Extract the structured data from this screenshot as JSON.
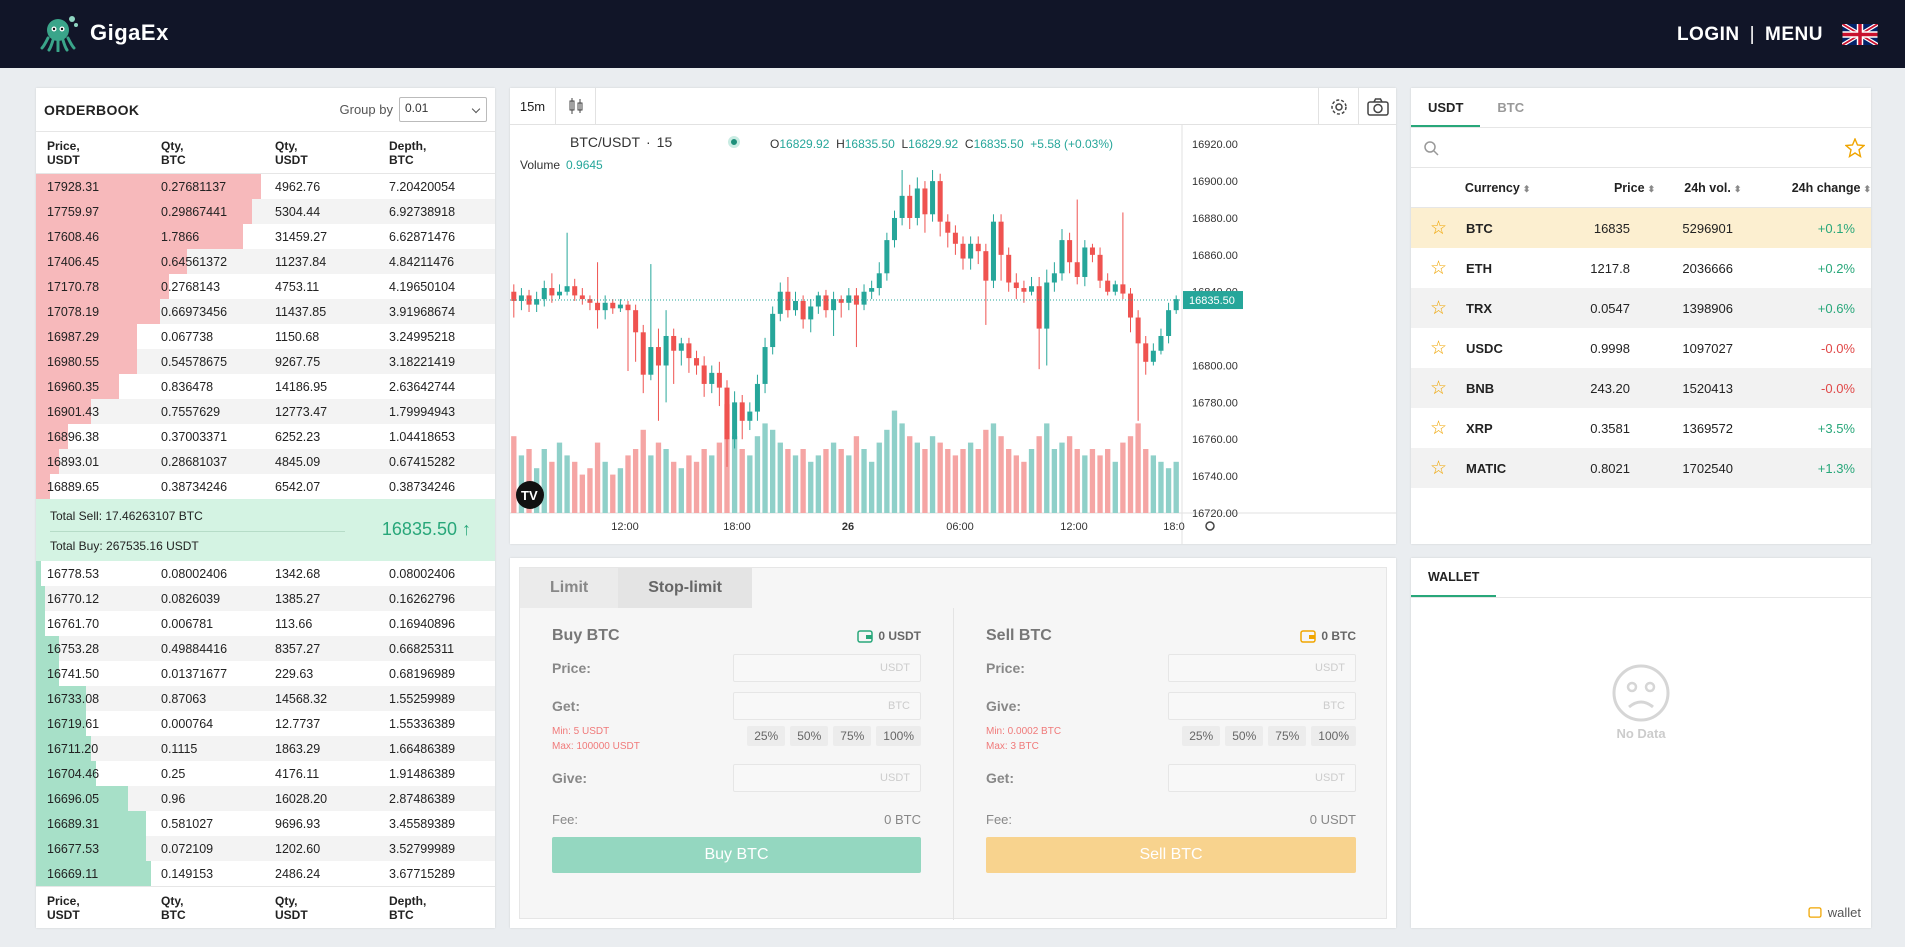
{
  "brand": {
    "name": "GigaEx"
  },
  "nav": {
    "login": "LOGIN",
    "separator": "|",
    "menu": "MENU"
  },
  "orderbook": {
    "title": "ORDERBOOK",
    "group_label": "Group by",
    "group_value": "0.01",
    "headers": [
      "Price,\nUSDT",
      "Qty,\nBTC",
      "Qty,\nUSDT",
      "Depth,\nBTC"
    ],
    "sells": [
      {
        "price": "17928.31",
        "qty": "0.27681137",
        "usdt": "4962.76",
        "depth": "7.20420054",
        "fill": 0.49
      },
      {
        "price": "17759.97",
        "qty": "0.29867441",
        "usdt": "5304.44",
        "depth": "6.92738918",
        "fill": 0.47
      },
      {
        "price": "17608.46",
        "qty": "1.7866",
        "usdt": "31459.27",
        "depth": "6.62871476",
        "fill": 0.45
      },
      {
        "price": "17406.45",
        "qty": "0.64561372",
        "usdt": "11237.84",
        "depth": "4.84211476",
        "fill": 0.33
      },
      {
        "price": "17170.78",
        "qty": "0.2768143",
        "usdt": "4753.11",
        "depth": "4.19650104",
        "fill": 0.29
      },
      {
        "price": "17078.19",
        "qty": "0.66973456",
        "usdt": "11437.85",
        "depth": "3.91968674",
        "fill": 0.27
      },
      {
        "price": "16987.29",
        "qty": "0.067738",
        "usdt": "1150.68",
        "depth": "3.24995218",
        "fill": 0.22
      },
      {
        "price": "16980.55",
        "qty": "0.54578675",
        "usdt": "9267.75",
        "depth": "3.18221419",
        "fill": 0.22
      },
      {
        "price": "16960.35",
        "qty": "0.836478",
        "usdt": "14186.95",
        "depth": "2.63642744",
        "fill": 0.18
      },
      {
        "price": "16901.43",
        "qty": "0.7557629",
        "usdt": "12773.47",
        "depth": "1.79994943",
        "fill": 0.12
      },
      {
        "price": "16896.38",
        "qty": "0.37003371",
        "usdt": "6252.23",
        "depth": "1.04418653",
        "fill": 0.07
      },
      {
        "price": "16893.01",
        "qty": "0.28681037",
        "usdt": "4845.09",
        "depth": "0.67415282",
        "fill": 0.05
      },
      {
        "price": "16889.65",
        "qty": "0.38734246",
        "usdt": "6542.07",
        "depth": "0.38734246",
        "fill": 0.03
      }
    ],
    "total_sell": "Total Sell: 17.46263107 BTC",
    "total_buy": "Total Buy: 267535.16 USDT",
    "last_price": "16835.50",
    "buys": [
      {
        "price": "16778.53",
        "qty": "0.08002406",
        "usdt": "1342.68",
        "depth": "0.08002406",
        "fill": 0.01
      },
      {
        "price": "16770.12",
        "qty": "0.0826039",
        "usdt": "1385.27",
        "depth": "0.16262796",
        "fill": 0.02
      },
      {
        "price": "16761.70",
        "qty": "0.006781",
        "usdt": "113.66",
        "depth": "0.16940896",
        "fill": 0.02
      },
      {
        "price": "16753.28",
        "qty": "0.49884416",
        "usdt": "8357.27",
        "depth": "0.66825311",
        "fill": 0.05
      },
      {
        "price": "16741.50",
        "qty": "0.01371677",
        "usdt": "229.63",
        "depth": "0.68196989",
        "fill": 0.05
      },
      {
        "price": "16733.08",
        "qty": "0.87063",
        "usdt": "14568.32",
        "depth": "1.55259989",
        "fill": 0.11
      },
      {
        "price": "16719.61",
        "qty": "0.000764",
        "usdt": "12.7737",
        "depth": "1.55336389",
        "fill": 0.11
      },
      {
        "price": "16711.20",
        "qty": "0.1115",
        "usdt": "1863.29",
        "depth": "1.66486389",
        "fill": 0.12
      },
      {
        "price": "16704.46",
        "qty": "0.25",
        "usdt": "4176.11",
        "depth": "1.91486389",
        "fill": 0.13
      },
      {
        "price": "16696.05",
        "qty": "0.96",
        "usdt": "16028.20",
        "depth": "2.87486389",
        "fill": 0.2
      },
      {
        "price": "16689.31",
        "qty": "0.581027",
        "usdt": "9696.93",
        "depth": "3.45589389",
        "fill": 0.24
      },
      {
        "price": "16677.53",
        "qty": "0.072109",
        "usdt": "1202.60",
        "depth": "3.52799989",
        "fill": 0.24
      },
      {
        "price": "16669.11",
        "qty": "0.149153",
        "usdt": "2486.24",
        "depth": "3.67715289",
        "fill": 0.25
      }
    ]
  },
  "chart": {
    "timeframe": "15m",
    "symbol": "BTC/USDT",
    "interval": "15",
    "ohlc": {
      "o": "16829.92",
      "h": "16835.50",
      "l": "16829.92",
      "c": "16835.50",
      "chg": "+5.58 (+0.03%)"
    },
    "volume_label": "Volume",
    "volume_value": "0.9645",
    "price_tag": "16835.50",
    "y_ticks": [
      "16920.00",
      "16900.00",
      "16880.00",
      "16860.00",
      "16840.00",
      "16800.00",
      "16780.00",
      "16760.00",
      "16740.00",
      "16720.00"
    ],
    "x_ticks": [
      "12:00",
      "18:00",
      "26",
      "06:00",
      "12:00",
      "18:0"
    ]
  },
  "chart_data": {
    "type": "candlestick",
    "ylim": [
      16720,
      16925
    ],
    "last": 16835.5,
    "candles": [
      [
        16840,
        16835,
        16844,
        16826
      ],
      [
        16835,
        16838,
        16842,
        16830
      ],
      [
        16838,
        16833,
        16841,
        16829
      ],
      [
        16833,
        16836,
        16840,
        16829
      ],
      [
        16836,
        16842,
        16846,
        16832
      ],
      [
        16842,
        16838,
        16850,
        16834
      ],
      [
        16838,
        16840,
        16844,
        16836
      ],
      [
        16840,
        16843,
        16872,
        16838
      ],
      [
        16843,
        16838,
        16847,
        16835
      ],
      [
        16838,
        16836,
        16842,
        16833
      ],
      [
        16836,
        16834,
        16838,
        16830
      ],
      [
        16834,
        16830,
        16856,
        16820
      ],
      [
        16830,
        16834,
        16838,
        16825
      ],
      [
        16834,
        16831,
        16836,
        16828
      ],
      [
        16831,
        16833,
        16836,
        16829
      ],
      [
        16833,
        16830,
        16835,
        16797
      ],
      [
        16830,
        16818,
        16833,
        16802
      ],
      [
        16818,
        16795,
        16822,
        16785
      ],
      [
        16795,
        16810,
        16855,
        16792
      ],
      [
        16810,
        16800,
        16820,
        16770
      ],
      [
        16800,
        16816,
        16830,
        16780
      ],
      [
        16816,
        16808,
        16820,
        16790
      ],
      [
        16808,
        16812,
        16815,
        16800
      ],
      [
        16812,
        16804,
        16815,
        16796
      ],
      [
        16804,
        16800,
        16808,
        16795
      ],
      [
        16800,
        16790,
        16805,
        16783
      ],
      [
        16790,
        16796,
        16800,
        16785
      ],
      [
        16796,
        16788,
        16802,
        16778
      ],
      [
        16788,
        16760,
        16792,
        16745
      ],
      [
        16760,
        16780,
        16786,
        16755
      ],
      [
        16780,
        16770,
        16784,
        16760
      ],
      [
        16770,
        16775,
        16780,
        16765
      ],
      [
        16775,
        16790,
        16795,
        16770
      ],
      [
        16790,
        16810,
        16815,
        16785
      ],
      [
        16810,
        16828,
        16832,
        16806
      ],
      [
        16828,
        16840,
        16845,
        16824
      ],
      [
        16840,
        16830,
        16848,
        16826
      ],
      [
        16830,
        16835,
        16840,
        16827
      ],
      [
        16835,
        16825,
        16838,
        16820
      ],
      [
        16825,
        16832,
        16836,
        16818
      ],
      [
        16832,
        16838,
        16840,
        16828
      ],
      [
        16838,
        16830,
        16841,
        16826
      ],
      [
        16830,
        16836,
        16840,
        16816
      ],
      [
        16836,
        16834,
        16838,
        16826
      ],
      [
        16834,
        16838,
        16842,
        16830
      ],
      [
        16838,
        16833,
        16842,
        16810
      ],
      [
        16833,
        16840,
        16844,
        16830
      ],
      [
        16840,
        16842,
        16846,
        16836
      ],
      [
        16842,
        16850,
        16856,
        16838
      ],
      [
        16850,
        16868,
        16872,
        16846
      ],
      [
        16868,
        16880,
        16884,
        16864
      ],
      [
        16880,
        16892,
        16906,
        16876
      ],
      [
        16892,
        16880,
        16898,
        16874
      ],
      [
        16880,
        16896,
        16902,
        16876
      ],
      [
        16896,
        16882,
        16900,
        16872
      ],
      [
        16882,
        16900,
        16906,
        16878
      ],
      [
        16900,
        16878,
        16904,
        16870
      ],
      [
        16878,
        16872,
        16882,
        16864
      ],
      [
        16872,
        16866,
        16876,
        16860
      ],
      [
        16866,
        16858,
        16870,
        16852
      ],
      [
        16858,
        16866,
        16870,
        16852
      ],
      [
        16866,
        16862,
        16870,
        16855
      ],
      [
        16862,
        16846,
        16866,
        16822
      ],
      [
        16846,
        16878,
        16882,
        16842
      ],
      [
        16878,
        16860,
        16882,
        16846
      ],
      [
        16860,
        16845,
        16864,
        16840
      ],
      [
        16845,
        16842,
        16850,
        16836
      ],
      [
        16842,
        16840,
        16846,
        16834
      ],
      [
        16840,
        16843,
        16848,
        16838
      ],
      [
        16843,
        16820,
        16848,
        16798
      ],
      [
        16820,
        16845,
        16852,
        16800
      ],
      [
        16845,
        16850,
        16856,
        16840
      ],
      [
        16850,
        16868,
        16874,
        16846
      ],
      [
        16868,
        16856,
        16872,
        16850
      ],
      [
        16856,
        16848,
        16890,
        16844
      ],
      [
        16848,
        16864,
        16868,
        16843
      ],
      [
        16864,
        16860,
        16866,
        16856
      ],
      [
        16860,
        16846,
        16864,
        16842
      ],
      [
        16846,
        16840,
        16850,
        16838
      ],
      [
        16840,
        16844,
        16846,
        16838
      ],
      [
        16844,
        16839,
        16883,
        16836
      ],
      [
        16839,
        16826,
        16842,
        16818
      ],
      [
        16826,
        16812,
        16830,
        16770
      ],
      [
        16812,
        16802,
        16816,
        16795
      ],
      [
        16802,
        16808,
        16812,
        16800
      ],
      [
        16808,
        16816,
        16820,
        16806
      ],
      [
        16816,
        16830,
        16834,
        16812
      ],
      [
        16830,
        16836,
        16838,
        16828
      ]
    ],
    "volumes": [
      0.6,
      0.45,
      0.5,
      0.35,
      0.5,
      0.4,
      0.55,
      0.45,
      0.4,
      0.3,
      0.35,
      0.55,
      0.4,
      0.3,
      0.35,
      0.45,
      0.5,
      0.65,
      0.45,
      0.55,
      0.5,
      0.4,
      0.35,
      0.45,
      0.4,
      0.5,
      0.45,
      0.55,
      0.85,
      0.6,
      0.5,
      0.45,
      0.6,
      0.7,
      0.65,
      0.55,
      0.5,
      0.45,
      0.5,
      0.4,
      0.45,
      0.5,
      0.55,
      0.5,
      0.45,
      0.6,
      0.5,
      0.4,
      0.55,
      0.65,
      0.8,
      0.7,
      0.6,
      0.55,
      0.5,
      0.6,
      0.55,
      0.5,
      0.45,
      0.5,
      0.55,
      0.5,
      0.65,
      0.7,
      0.6,
      0.5,
      0.45,
      0.4,
      0.5,
      0.6,
      0.7,
      0.5,
      0.55,
      0.6,
      0.5,
      0.45,
      0.5,
      0.45,
      0.5,
      0.4,
      0.55,
      0.6,
      0.7,
      0.5,
      0.45,
      0.4,
      0.35,
      0.4
    ]
  },
  "trade": {
    "tab_limit": "Limit",
    "tab_stop": "Stop-limit",
    "buy": {
      "title": "Buy BTC",
      "balance": "0 USDT",
      "price_label": "Price:",
      "price_unit": "USDT",
      "get_label": "Get:",
      "get_unit": "BTC",
      "min": "Min: 5 USDT",
      "max": "Max: 100000 USDT",
      "give_label": "Give:",
      "give_unit": "USDT",
      "fee_label": "Fee:",
      "fee_value": "0 BTC",
      "button": "Buy BTC"
    },
    "sell": {
      "title": "Sell BTC",
      "balance": "0 BTC",
      "price_label": "Price:",
      "price_unit": "USDT",
      "give_label": "Give:",
      "give_unit": "BTC",
      "min": "Min: 0.0002 BTC",
      "max": "Max: 3 BTC",
      "get_label": "Get:",
      "get_unit": "USDT",
      "fee_label": "Fee:",
      "fee_value": "0 USDT",
      "button": "Sell BTC"
    },
    "pcts": [
      "25%",
      "50%",
      "75%",
      "100%"
    ]
  },
  "market": {
    "tabs": [
      "USDT",
      "BTC"
    ],
    "headers": {
      "currency": "Currency",
      "price": "Price",
      "vol": "24h vol.",
      "change": "24h change"
    },
    "rows": [
      {
        "sym": "BTC",
        "price": "16835",
        "vol": "5296901",
        "chg": "+0.1%",
        "dir": "pos"
      },
      {
        "sym": "ETH",
        "price": "1217.8",
        "vol": "2036666",
        "chg": "+0.2%",
        "dir": "pos"
      },
      {
        "sym": "TRX",
        "price": "0.0547",
        "vol": "1398906",
        "chg": "+0.6%",
        "dir": "pos"
      },
      {
        "sym": "USDC",
        "price": "0.9998",
        "vol": "1097027",
        "chg": "-0.0%",
        "dir": "neg"
      },
      {
        "sym": "BNB",
        "price": "243.20",
        "vol": "1520413",
        "chg": "-0.0%",
        "dir": "neg"
      },
      {
        "sym": "XRP",
        "price": "0.3581",
        "vol": "1369572",
        "chg": "+3.5%",
        "dir": "pos"
      },
      {
        "sym": "MATIC",
        "price": "0.8021",
        "vol": "1702540",
        "chg": "+1.3%",
        "dir": "pos"
      }
    ]
  },
  "wallet": {
    "tab": "WALLET",
    "nodata": "No Data",
    "footer": "wallet"
  },
  "colors": {
    "up": "#26a69a",
    "down": "#ef5350",
    "accent": "#28a77a",
    "header": "#111528"
  }
}
